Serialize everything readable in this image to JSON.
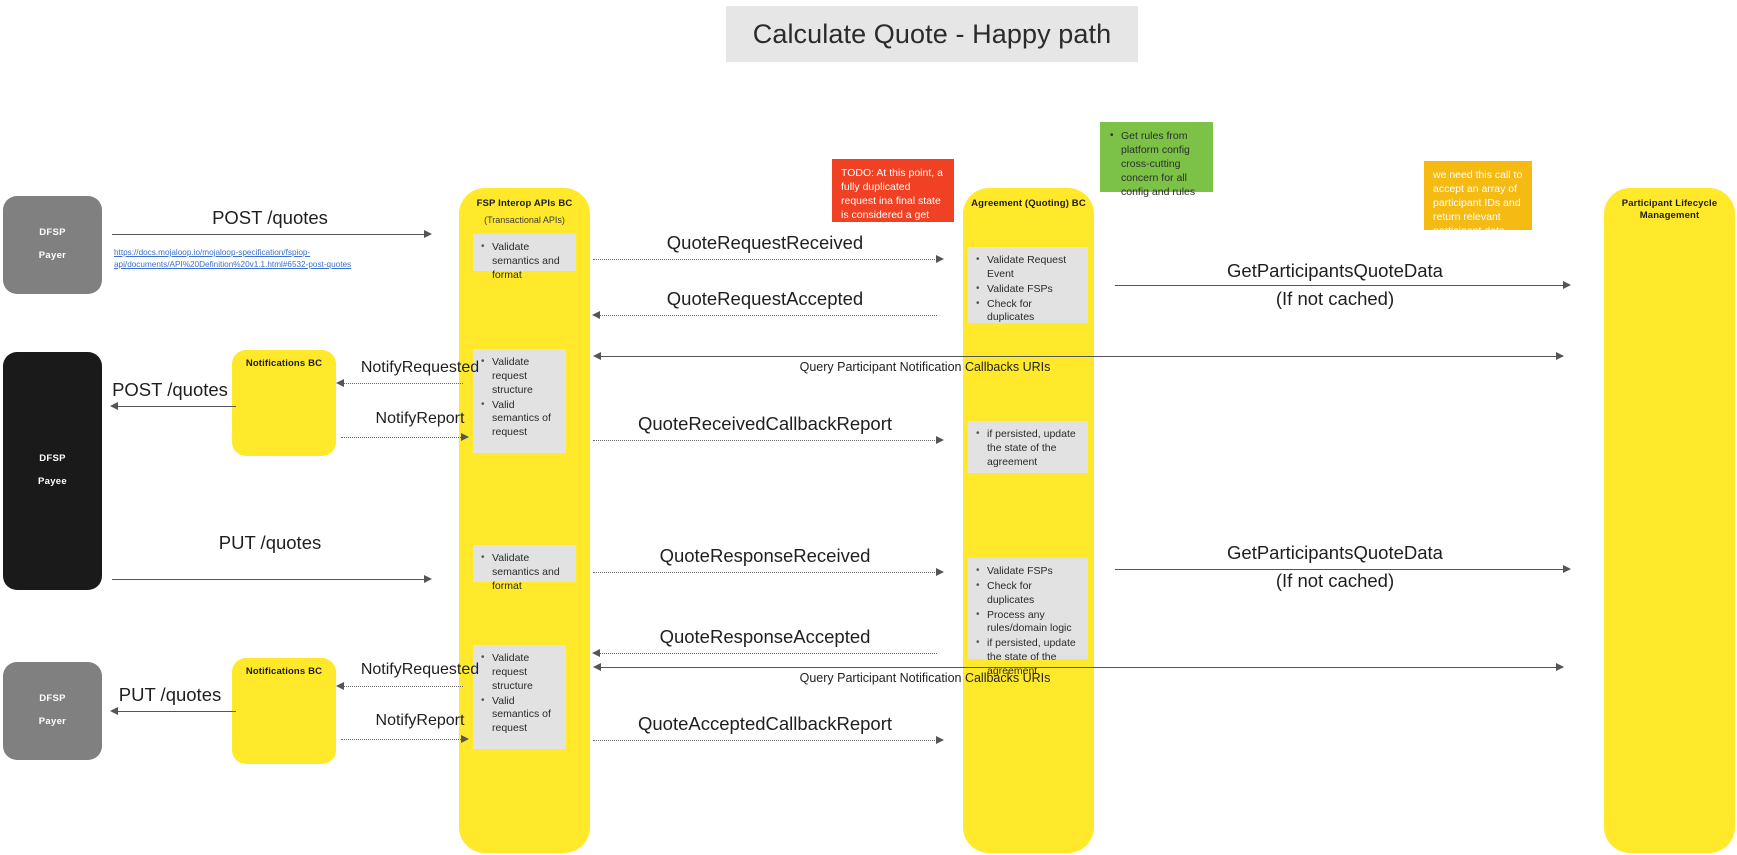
{
  "title": "Calculate Quote - Happy path",
  "colors": {
    "lane": "#ffe92a",
    "actor_payer": "#808080",
    "actor_payee": "#1a1a1a",
    "note": "#e2e2e2",
    "sticky_red": "#f04124",
    "sticky_green": "#7cc246",
    "sticky_orange": "#f5bb12",
    "title_bg": "#e6e6e6",
    "link": "#3b6fd4"
  },
  "actors": {
    "payer_top": {
      "line1": "DFSP",
      "line2": "Payer"
    },
    "payee": {
      "line1": "DFSP",
      "line2": "Payee"
    },
    "payer_bottom": {
      "line1": "DFSP",
      "line2": "Payer"
    }
  },
  "lanes": {
    "fsp_interop": {
      "title": "FSP Interop APIs BC",
      "subtitle": "(Transactional APIs)"
    },
    "notifications_top": {
      "title": "Notifications BC"
    },
    "notifications_bottom": {
      "title": "Notifications BC"
    },
    "agreement": {
      "title": "Agreement (Quoting) BC"
    },
    "participant": {
      "title": "Participant Lifecycle Management"
    }
  },
  "notes": {
    "fsp_validate_1": [
      "Validate semantics and format"
    ],
    "fsp_notify_1": [
      "Validate request structure",
      "Valid semantics of request"
    ],
    "fsp_validate_2": [
      "Validate semantics and format"
    ],
    "fsp_notify_2": [
      "Validate request structure",
      "Valid semantics of request"
    ],
    "agreement_1": [
      "Validate Request Event",
      "Validate FSPs",
      "Check for duplicates"
    ],
    "agreement_2": [
      "if persisted, update the state of the agreement"
    ],
    "agreement_3": [
      "Validate FSPs",
      "Check for duplicates",
      "Process any rules/domain logic",
      "if persisted, update the state of the agreement"
    ]
  },
  "stickies": {
    "red": "TODO: At this point, a fully duplicated request ina final state is considered a get request",
    "green": [
      "Get rules from platform config cross-cutting concern for all config and rules"
    ],
    "orange": "we need this call to accept an array of participant IDs and return relevant participant data, including status flags"
  },
  "messages": {
    "post_quotes_1": "POST /quotes",
    "post_quotes_link": "https://docs.mojaloop.io/mojaloop-specification/fspiop-api/documents/API%20Definition%20v1.1.html#6532-post-quotes",
    "quote_request_received": "QuoteRequestReceived",
    "quote_request_accepted": "QuoteRequestAccepted",
    "get_participants_quote_data_1": "GetParticipantsQuoteData",
    "get_participants_quote_data_1_sub": "(If not cached)",
    "query_callbacks_1": "Query Participant Notification Callbacks URIs",
    "notify_requested_1": "NotifyRequested",
    "notify_report_1": "NotifyReport",
    "post_quotes_2": "POST /quotes",
    "quote_received_callback_report": "QuoteReceivedCallbackReport",
    "put_quotes_1": "PUT /quotes",
    "quote_response_received": "QuoteResponseReceived",
    "get_participants_quote_data_2": "GetParticipantsQuoteData",
    "get_participants_quote_data_2_sub": "(If not cached)",
    "quote_response_accepted": "QuoteResponseAccepted",
    "query_callbacks_2": "Query Participant Notification Callbacks URIs",
    "notify_requested_2": "NotifyRequested",
    "notify_report_2": "NotifyReport",
    "put_quotes_2": "PUT /quotes",
    "quote_accepted_callback_report": "QuoteAcceptedCallbackReport"
  }
}
